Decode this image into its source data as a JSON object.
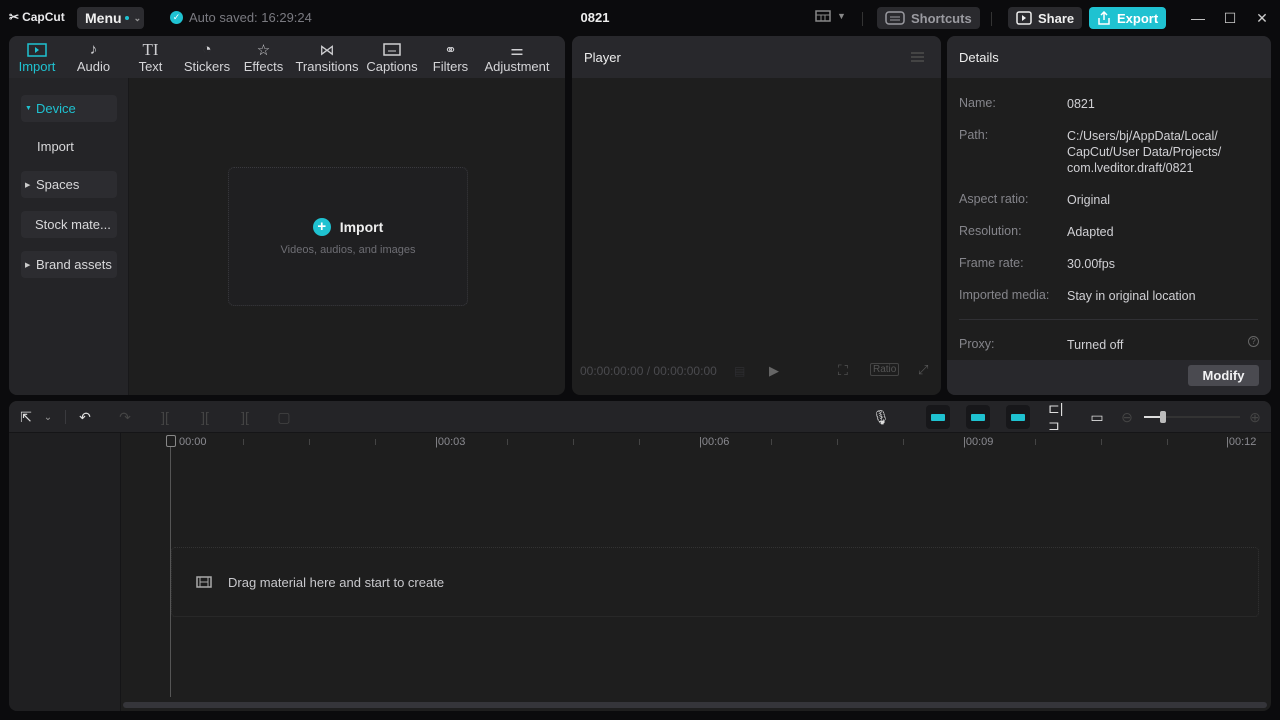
{
  "app": {
    "name": "CapCut",
    "menu_label": "Menu",
    "autosave": "Auto saved: 16:29:24",
    "project_title": "0821"
  },
  "titlebar": {
    "shortcuts_label": "Shortcuts",
    "share_label": "Share",
    "export_label": "Export"
  },
  "media_tabs": [
    {
      "label": "Import",
      "icon": "import-icon",
      "active": true
    },
    {
      "label": "Audio",
      "icon": "audio-icon"
    },
    {
      "label": "Text",
      "icon": "text-icon"
    },
    {
      "label": "Stickers",
      "icon": "stickers-icon"
    },
    {
      "label": "Effects",
      "icon": "effects-icon"
    },
    {
      "label": "Transitions",
      "icon": "transitions-icon"
    },
    {
      "label": "Captions",
      "icon": "captions-icon"
    },
    {
      "label": "Filters",
      "icon": "filters-icon"
    },
    {
      "label": "Adjustment",
      "icon": "adjustment-icon"
    }
  ],
  "sidebar": {
    "items": [
      {
        "label": "Device",
        "expanded": true
      },
      {
        "label": "Import"
      },
      {
        "label": "Spaces"
      },
      {
        "label": "Stock mate..."
      },
      {
        "label": "Brand assets"
      }
    ]
  },
  "import_zone": {
    "title": "Import",
    "subtitle": "Videos, audios, and images"
  },
  "player": {
    "title": "Player",
    "timecode": "00:00:00:00 / 00:00:00:00",
    "ratio_label": "Ratio"
  },
  "details": {
    "title": "Details",
    "rows": [
      {
        "key": "Name:",
        "value": "0821"
      },
      {
        "key": "Path:",
        "value": "C:/Users/bj/AppData/Local/ CapCut/User Data/Projects/ com.lveditor.draft/0821"
      },
      {
        "key": "Aspect ratio:",
        "value": "Original"
      },
      {
        "key": "Resolution:",
        "value": "Adapted"
      },
      {
        "key": "Frame rate:",
        "value": "30.00fps"
      },
      {
        "key": "Imported media:",
        "value": "Stay in original location"
      },
      {
        "key": "Proxy:",
        "value": "Turned off"
      }
    ],
    "modify_label": "Modify"
  },
  "timeline": {
    "ruler_labels": [
      "00:00",
      "|00:03",
      "|00:06",
      "|00:09",
      "|00:12"
    ],
    "drop_hint": "Drag material here and start to create",
    "zoom_level": 0.2
  },
  "colors": {
    "accent": "#1fc2d1",
    "panel": "#1e1e1e",
    "header": "#28282c"
  }
}
